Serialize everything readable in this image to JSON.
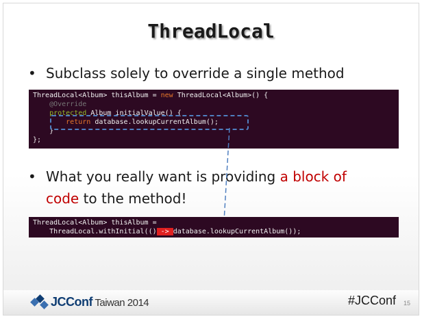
{
  "slide": {
    "title": "ThreadLocal",
    "bullets": [
      {
        "text": "Subclass solely to override a single method"
      },
      {
        "text_before": "What you really want is providing ",
        "text_highlight_1": "a block of",
        "text_highlight_2": "code",
        "text_after": " to the method!"
      }
    ],
    "code_block_1": {
      "line1_a": "ThreadLocal<Album> thisAlbum = ",
      "line1_kw": "new",
      "line1_b": " ThreadLocal<Album>() {",
      "line2": "    @Override",
      "line3_kw": "    protected",
      "line3_b": " Album initialValue() {",
      "line4_kw": "        return",
      "line4_b": " database.lookupCurrentAlbum();",
      "line5": "    }",
      "line6": "};"
    },
    "code_block_2": {
      "line1": "ThreadLocal<Album> thisAlbum =",
      "line2_a": "    ThreadLocal.withInitial(()",
      "line2_arrow": " -> ",
      "line2_b": "database.lookupCurrentAlbum());"
    },
    "footer": {
      "logo_jc": "JCConf",
      "logo_rest": " Taiwan 2014",
      "hashtag": "#JCConf",
      "page_number": "15"
    },
    "colors": {
      "code_background": "#2d0922",
      "highlight_red": "#c00000",
      "dash_blue": "#4f7fc0"
    }
  }
}
